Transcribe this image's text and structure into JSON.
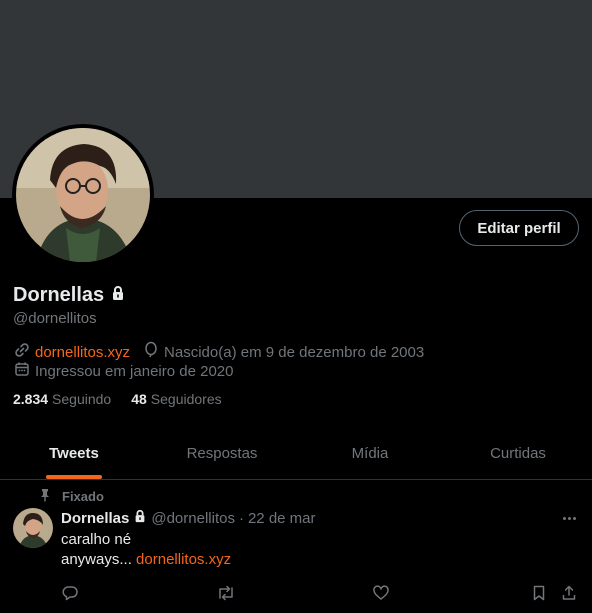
{
  "profile": {
    "name": "Dornellas",
    "handle": "@dornellitos",
    "website": "dornellitos.xyz",
    "birthday": "Nascido(a) em 9 de dezembro de 2003",
    "joined": "Ingressou em janeiro de 2020",
    "edit_button": "Editar perfil",
    "following_count": "2.834",
    "following_label": "Seguindo",
    "followers_count": "48",
    "followers_label": "Seguidores"
  },
  "tabs": [
    {
      "label": "Tweets",
      "active": true
    },
    {
      "label": "Respostas",
      "active": false
    },
    {
      "label": "Mídia",
      "active": false
    },
    {
      "label": "Curtidas",
      "active": false
    }
  ],
  "tweet": {
    "pinned_label": "Fixado",
    "name": "Dornellas",
    "handle": "@dornellitos",
    "dot": "·",
    "date": "22 de mar",
    "line1": "caralho né",
    "line2_prefix": "anyways...",
    "line2_link": "dornellitos.xyz"
  },
  "icons": {
    "lock": "lock-icon",
    "link": "link-icon",
    "birthday": "balloon-icon",
    "calendar": "calendar-icon",
    "pin": "pin-icon",
    "reply": "reply-icon",
    "retweet": "retweet-icon",
    "like": "heart-icon",
    "bookmark": "bookmark-icon",
    "share": "share-icon",
    "more": "more-icon"
  },
  "colors": {
    "accent": "#f4661b",
    "background": "#000000",
    "banner": "#333639",
    "text_primary": "#e7e9ea",
    "text_secondary": "#71767b"
  }
}
